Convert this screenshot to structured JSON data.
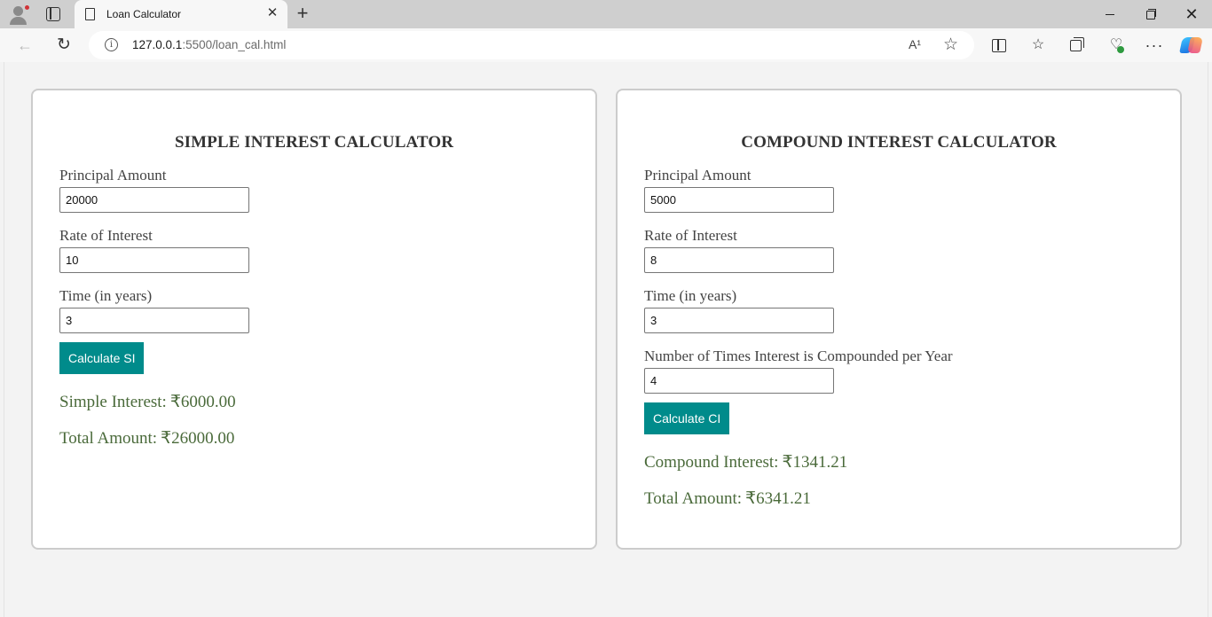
{
  "browser": {
    "tab_title": "Loan Calculator",
    "url_host": "127.0.0.1",
    "url_path": ":5500/loan_cal.html",
    "read_aloud_label": "A¹"
  },
  "simple": {
    "title": "SIMPLE INTEREST CALCULATOR",
    "principal_label": "Principal Amount",
    "principal_value": "20000",
    "rate_label": "Rate of Interest",
    "rate_value": "10",
    "time_label": "Time (in years)",
    "time_value": "3",
    "button_label": "Calculate SI",
    "interest_label": "Simple Interest:",
    "interest_value": "₹6000.00",
    "total_label": "Total Amount:",
    "total_value": "₹26000.00"
  },
  "compound": {
    "title": "COMPOUND INTEREST CALCULATOR",
    "principal_label": "Principal Amount",
    "principal_value": "5000",
    "rate_label": "Rate of Interest",
    "rate_value": "8",
    "time_label": "Time (in years)",
    "time_value": "3",
    "freq_label": "Number of Times Interest is Compounded per Year",
    "freq_value": "4",
    "button_label": "Calculate CI",
    "interest_label": "Compound Interest:",
    "interest_value": "₹1341.21",
    "total_label": "Total Amount:",
    "total_value": "₹6341.21"
  },
  "colors": {
    "button_bg": "#008b8b",
    "result_text": "#4a6a3a",
    "card_border": "#cccccc"
  }
}
